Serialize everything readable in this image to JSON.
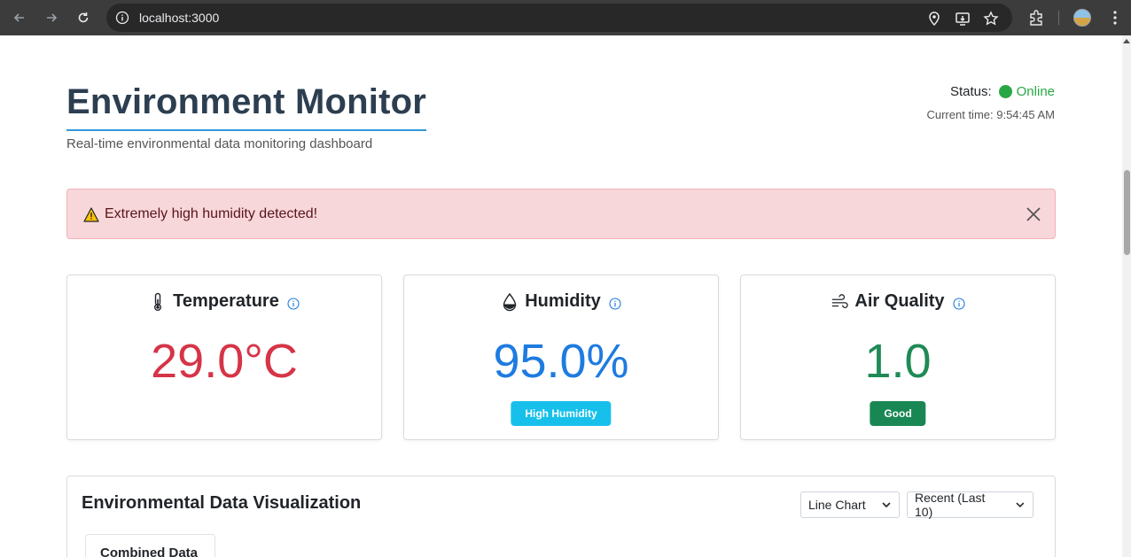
{
  "browser": {
    "url": "localhost:3000",
    "icons": [
      "back-icon",
      "forward-icon",
      "reload-icon",
      "site-info-icon",
      "location-icon",
      "install-app-icon",
      "bookmark-star-icon",
      "extensions-icon",
      "profile-avatar",
      "menu-kebab-icon"
    ]
  },
  "header": {
    "title": "Environment Monitor",
    "subtitle": "Real-time environmental data monitoring dashboard",
    "status_label": "Status:",
    "status_value": "Online",
    "current_time": "Current time: 9:54:45 AM"
  },
  "alert": {
    "message": "Extremely high humidity detected!",
    "icon": "warning-icon"
  },
  "cards": [
    {
      "label": "Temperature",
      "value": "29.0°C",
      "icon": "thermometer-icon",
      "color": "#d63447",
      "badge": ""
    },
    {
      "label": "Humidity",
      "value": "95.0%",
      "icon": "droplet-icon",
      "color": "#1e7be0",
      "badge": "High Humidity",
      "badge_color": "#17c0eb"
    },
    {
      "label": "Air Quality",
      "value": "1.0",
      "icon": "wind-icon",
      "color": "#1f8a55",
      "badge": "Good",
      "badge_color": "#198754"
    }
  ],
  "visualization": {
    "title": "Environmental Data Visualization",
    "chart_type_select": "Line Chart",
    "range_select": "Recent (Last 10)",
    "tabs": [
      "Combined Data"
    ]
  },
  "colors": {
    "status_online": "#28a745",
    "title": "#2c3e50",
    "title_underline": "#3498db",
    "alert_bg": "#f8d7da"
  }
}
